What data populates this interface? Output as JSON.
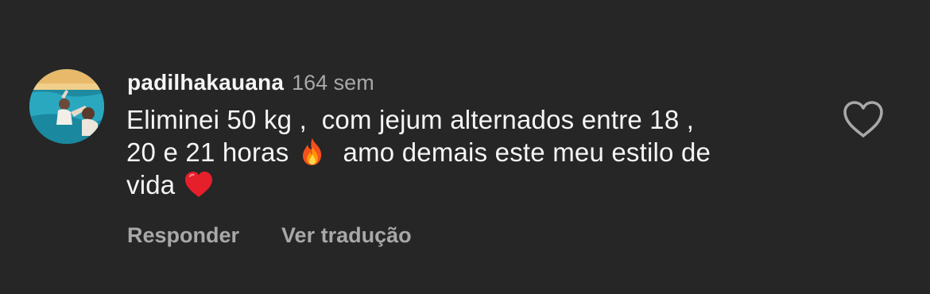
{
  "comment": {
    "username": "padilhakauana",
    "timestamp": "164 sem",
    "text_lines": [
      "Eliminei 50 kg ,  com jejum alternados entre 18 ,",
      "20 e 21 horas",
      "amo demais este meu estilo de",
      "vida"
    ],
    "emojis": [
      "fire-emoji",
      "red-heart-emoji"
    ],
    "like_icon": "heart-outline-icon"
  },
  "actions": {
    "reply_label": "Responder",
    "translate_label": "Ver tradução"
  },
  "colors": {
    "background": "#262626",
    "primary_text": "#f5f5f5",
    "secondary_text": "#a8a8a8"
  }
}
